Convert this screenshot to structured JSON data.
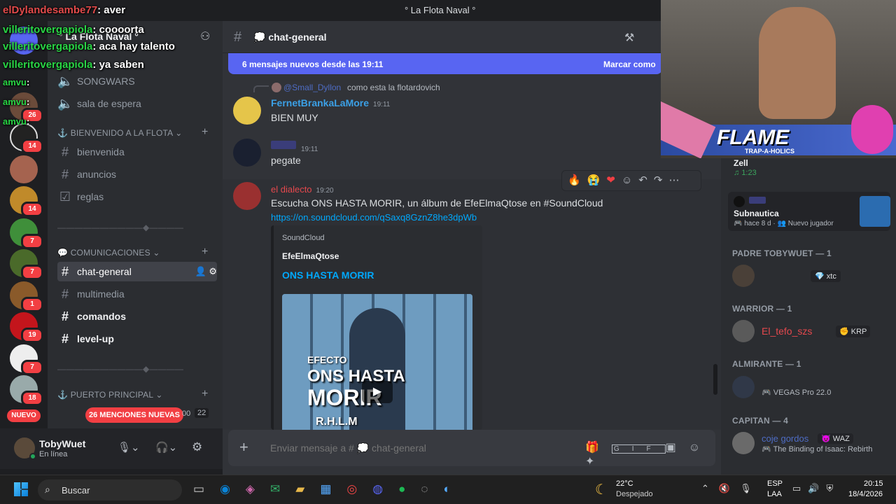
{
  "window": {
    "title": "° La Flota Naval °"
  },
  "server": {
    "name": "° La Flota Naval °"
  },
  "rail": {
    "badges": [
      "26",
      "14",
      "14",
      "7",
      "7",
      "1",
      "19",
      "7",
      "18"
    ],
    "new_label": "NUEVO"
  },
  "sidebar": {
    "channels_top": [
      "SONGWARS",
      "sala de espera"
    ],
    "cat_bienvenido": "BIENVENIDO A LA FLOTA",
    "ch_bienvenida": "bienvenida",
    "ch_anuncios": "anuncios",
    "ch_reglas": "reglas",
    "divider1": "——————————◆————",
    "cat_comunicaciones": "COMUNICACIONES",
    "ch_chat_general": "chat-general",
    "ch_multimedia": "multimedia",
    "ch_comandos": "comandos",
    "ch_levelup": "level-up",
    "divider2": "——————————◆————",
    "cat_puerto": "PUERTO PRINCIPAL",
    "mentions_pill": "26 MENCIONES NUEVAS",
    "voice_counts": [
      "00",
      "22"
    ]
  },
  "user": {
    "name": "TobyWuet",
    "status": "En línea"
  },
  "channel": {
    "name": "chat-general"
  },
  "new_messages": {
    "text": "6 mensajes nuevos desde las 19:11",
    "mark": "Marcar como"
  },
  "messages": {
    "reply_to_user": "@Small_Dyllon",
    "reply_text": "como esta la flotardovich",
    "m1": {
      "author": "FernetBrankaLaMore",
      "time": "19:11",
      "text": "BIEN MUY"
    },
    "m2": {
      "time": "19:11",
      "text": "pegate"
    },
    "m3": {
      "author": "el dialecto",
      "time": "19:20",
      "text": "Escucha ONS HASTA MORIR, un álbum de EfeElmaQtose en #SoundCloud",
      "link": "https://on.soundcloud.com/qSaxq8GznZ8he3dpWb",
      "embed_provider": "SoundCloud",
      "embed_author": "EfeElmaQtose",
      "embed_title": "ONS HASTA MORIR",
      "cover_text1": "EFECTO",
      "cover_text2": "ONS HASTA",
      "cover_text3": "MORIR",
      "cover_text4": "R.H.L.M"
    }
  },
  "composer": {
    "placeholder": "Enviar mensaje a # 💭 chat-general"
  },
  "members": {
    "zell": {
      "name": "Zell",
      "activity": "1:23"
    },
    "game_user": {
      "game": "Subnautica",
      "when": "hace 8 d",
      "note": "Nuevo jugador"
    },
    "padre_head": "PADRE TOBYWUET — 1",
    "padre_tag": "xtc",
    "warrior_head": "WARRIOR — 1",
    "warrior_name": "El_tefo_szs",
    "warrior_tag": "KRP",
    "almirante_head": "ALMIRANTE — 1",
    "almirante_activity": "VEGAS Pro 22.0",
    "capitan_head": "CAPITAN — 4",
    "capitan_name": "coje gordos",
    "capitan_tag": "WAZ",
    "capitan_activity": "The Binding of Isaac: Rebirth"
  },
  "overlay_chat": [
    {
      "user": "elDylandesambe77",
      "msg": "aver"
    },
    {
      "user": "villeritovergapiola",
      "msg": "coooorta"
    },
    {
      "user": "villeritovergapiola",
      "msg": "aca hay talento"
    },
    {
      "user": "villeritovergapiola",
      "msg": "ya saben"
    },
    {
      "user": "amvu",
      "msg": ""
    },
    {
      "user": "amvu",
      "msg": ""
    },
    {
      "user": "amvu",
      "msg": ""
    }
  ],
  "webcam": {
    "banner": "FLAME",
    "sub": "TRAP-A-HOLICS"
  },
  "taskbar": {
    "search": "Buscar",
    "weather_temp": "22°C",
    "weather_desc": "Despejado",
    "lang1": "ESP",
    "lang2": "LAA",
    "time": "20:15",
    "date": "18/4/2026"
  },
  "colors": {
    "blurple": "#5865f2",
    "green": "#23a55a",
    "red": "#f23f43",
    "link": "#00a8fc"
  }
}
